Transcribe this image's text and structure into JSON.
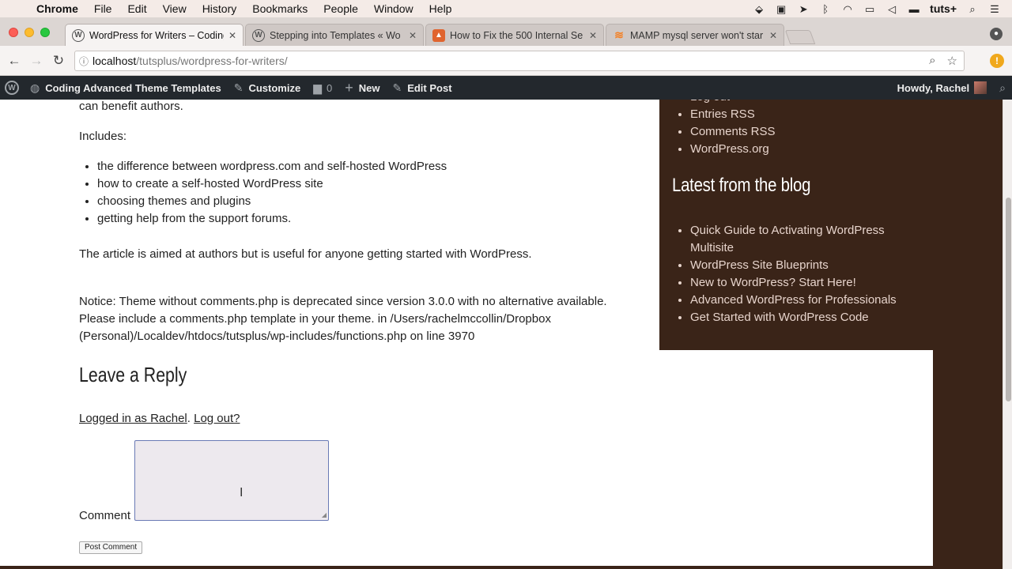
{
  "menubar": {
    "apple_icon": "apple-icon",
    "app": "Chrome",
    "items": [
      "File",
      "Edit",
      "View",
      "History",
      "Bookmarks",
      "People",
      "Window",
      "Help"
    ],
    "user": "tuts+"
  },
  "tabs": [
    {
      "title": "WordPress for Writers – Coding",
      "favicon": "wordpress-icon",
      "active": true
    },
    {
      "title": "Stepping into Templates « Wo",
      "favicon": "wordpress-icon",
      "active": false
    },
    {
      "title": "How to Fix the 500 Internal Se",
      "favicon": "orange-site-icon",
      "active": false
    },
    {
      "title": "MAMP mysql server won't star",
      "favicon": "stackoverflow-icon",
      "active": false
    }
  ],
  "omnibox": {
    "host": "localhost",
    "path": "/tutsplus/wordpress-for-writers/"
  },
  "adminbar": {
    "site": "Coding Advanced Theme Templates",
    "customize": "Customize",
    "comments_count": "0",
    "new": "New",
    "edit": "Edit Post",
    "howdy": "Howdy, Rachel"
  },
  "article": {
    "lead_tail": "can benefit authors.",
    "includes": "Includes:",
    "list": [
      "the difference between wordpress.com and self-hosted WordPress",
      "how to create a self-hosted WordPress site",
      "choosing themes and plugins",
      "getting help from the support forums."
    ],
    "closing": "The article is aimed at authors but is useful for anyone getting started with WordPress.",
    "notice": [
      "Notice: Theme without comments.php is deprecated since version 3.0.0 with no alternative available.",
      "Please include a comments.php template in your theme. in /Users/rachelmccollin/Dropbox",
      "(Personal)/Localdev/htdocs/tutsplus/wp-includes/functions.php on line 3970"
    ]
  },
  "reply": {
    "title": "Leave a Reply",
    "logged_in": "Logged in as Rachel",
    "sep": ".",
    "logout": "Log out?",
    "comment_label": "Comment",
    "submit": "Post Comment"
  },
  "sidebar": {
    "meta_partial": "Log out",
    "meta": [
      "Entries RSS",
      "Comments RSS",
      "WordPress.org"
    ],
    "blog_title": "Latest from the blog",
    "blog": [
      "Quick Guide to Activating WordPress Multisite",
      "WordPress Site Blueprints",
      "New to WordPress? Start Here!",
      "Advanced WordPress for Professionals",
      "Get Started with WordPress Code"
    ]
  }
}
